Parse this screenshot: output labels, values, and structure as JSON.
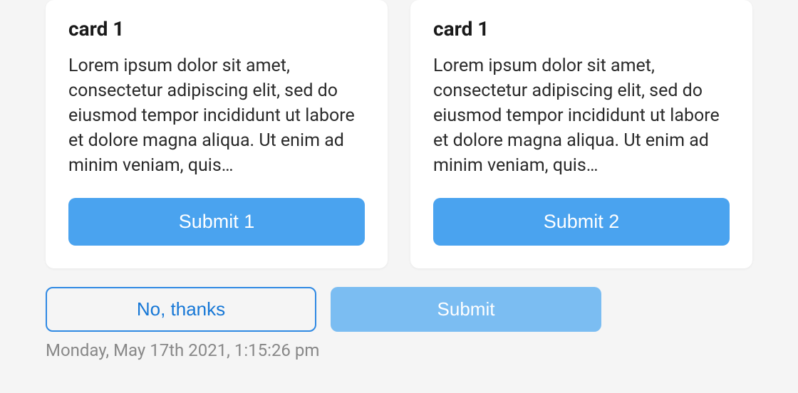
{
  "cards": [
    {
      "title": "card 1",
      "body": "Lorem ipsum dolor sit amet, consectetur adipiscing elit, sed do eiusmod tempor incididunt ut labore et dolore magna aliqua. Ut enim ad minim veniam, quis…",
      "button_label": "Submit 1"
    },
    {
      "title": "card 1",
      "body": "Lorem ipsum dolor sit amet, consectetur adipiscing elit, sed do eiusmod tempor incididunt ut labore et dolore magna aliqua. Ut enim ad minim veniam, quis…",
      "button_label": "Submit 2"
    }
  ],
  "footer": {
    "no_thanks_label": "No, thanks",
    "submit_label": "Submit",
    "timestamp": "Monday, May 17th 2021, 1:15:26 pm"
  }
}
